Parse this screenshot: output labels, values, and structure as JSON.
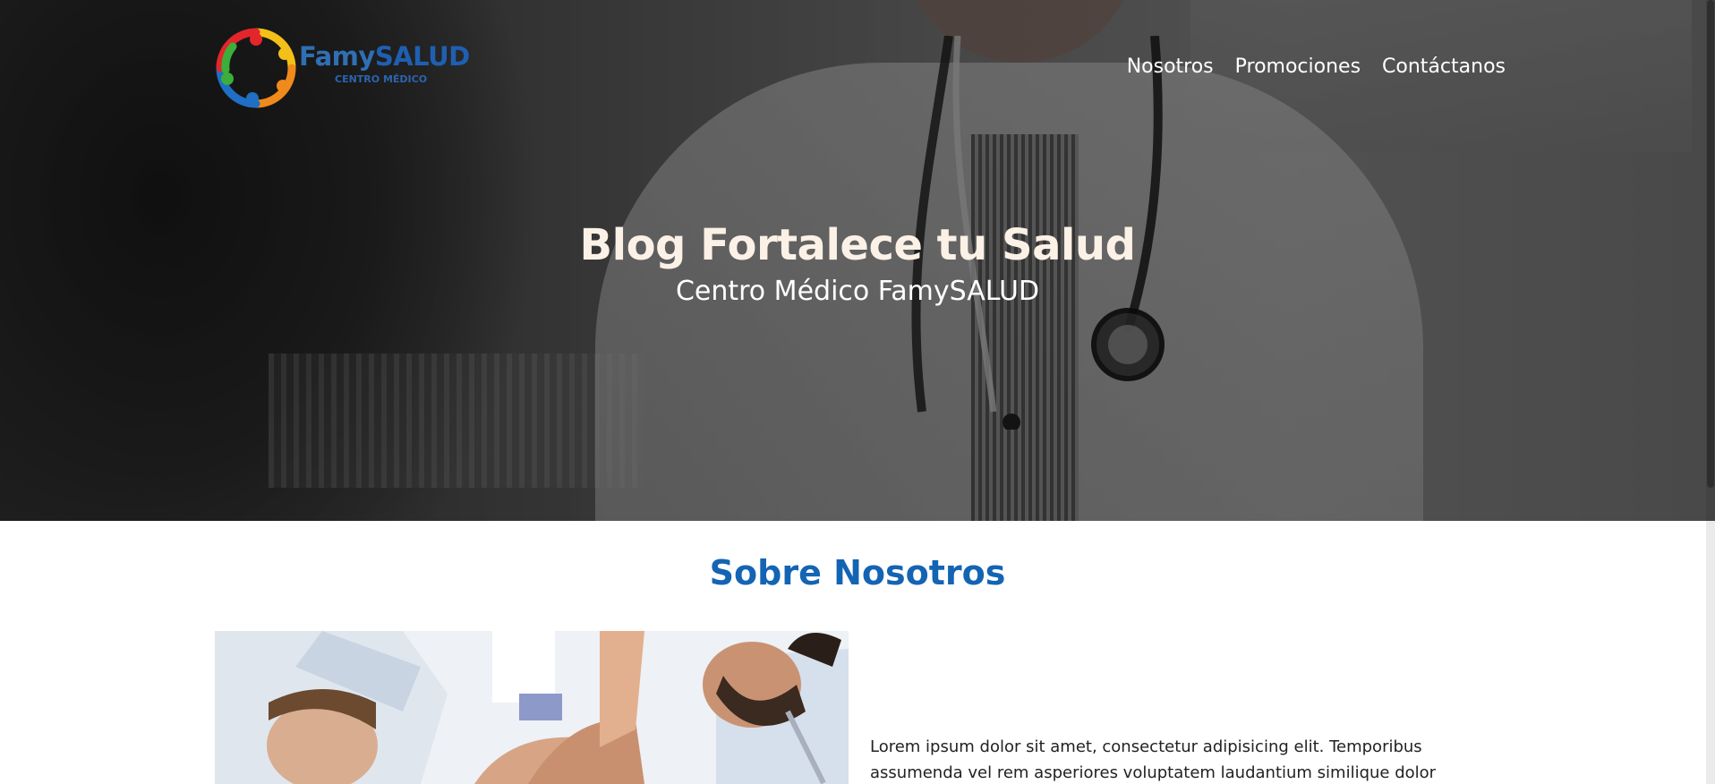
{
  "brand": {
    "name_part1": "Famy",
    "name_part2": "SALUD",
    "tagline": "CENTRO MÉDICO"
  },
  "nav": {
    "items": [
      {
        "label": "Nosotros"
      },
      {
        "label": "Promociones"
      },
      {
        "label": "Contáctanos"
      }
    ]
  },
  "hero": {
    "title": "Blog Fortalece tu Salud",
    "subtitle": "Centro Médico FamySALUD"
  },
  "about": {
    "title": "Sobre Nosotros",
    "text": "Lorem ipsum dolor sit amet, consectetur adipisicing elit. Temporibus assumenda vel rem asperiores voluptatem laudantium similique dolor"
  },
  "colors": {
    "accent_blue": "#1464b4",
    "hero_title": "#fbf1e6",
    "nav_text": "#ffffff"
  }
}
